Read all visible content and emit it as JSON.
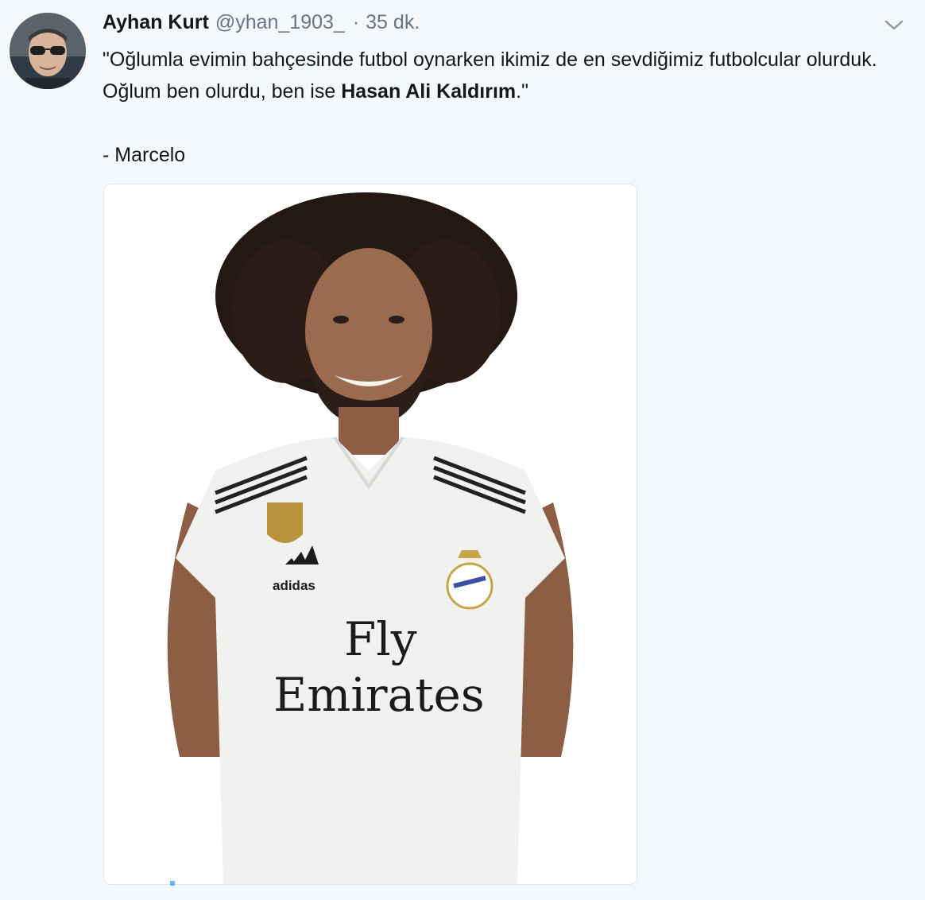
{
  "tweet": {
    "author_name": "Ayhan Kurt",
    "author_handle": "@yhan_1903_",
    "separator": "·",
    "timestamp": "35 dk.",
    "text_before_bold": "\"Oğlumla evimin bahçesinde futbol oynarken ikimiz de en sevdiğimiz futbolcular olurduk. Oğlum ben olurdu, ben ise ",
    "text_bold": "Hasan Ali Kaldırım",
    "text_after_bold": ".\"",
    "signature": "- Marcelo"
  },
  "media": {
    "jersey_brand": "adidas",
    "sponsor_line1": "Fly",
    "sponsor_line2": "Emirates"
  },
  "icons": {
    "menu": "chevron-down-icon"
  },
  "colors": {
    "background": "#f5f8fa",
    "text": "#14171a",
    "secondary_text": "#657786",
    "accent": "#1da1f2"
  }
}
